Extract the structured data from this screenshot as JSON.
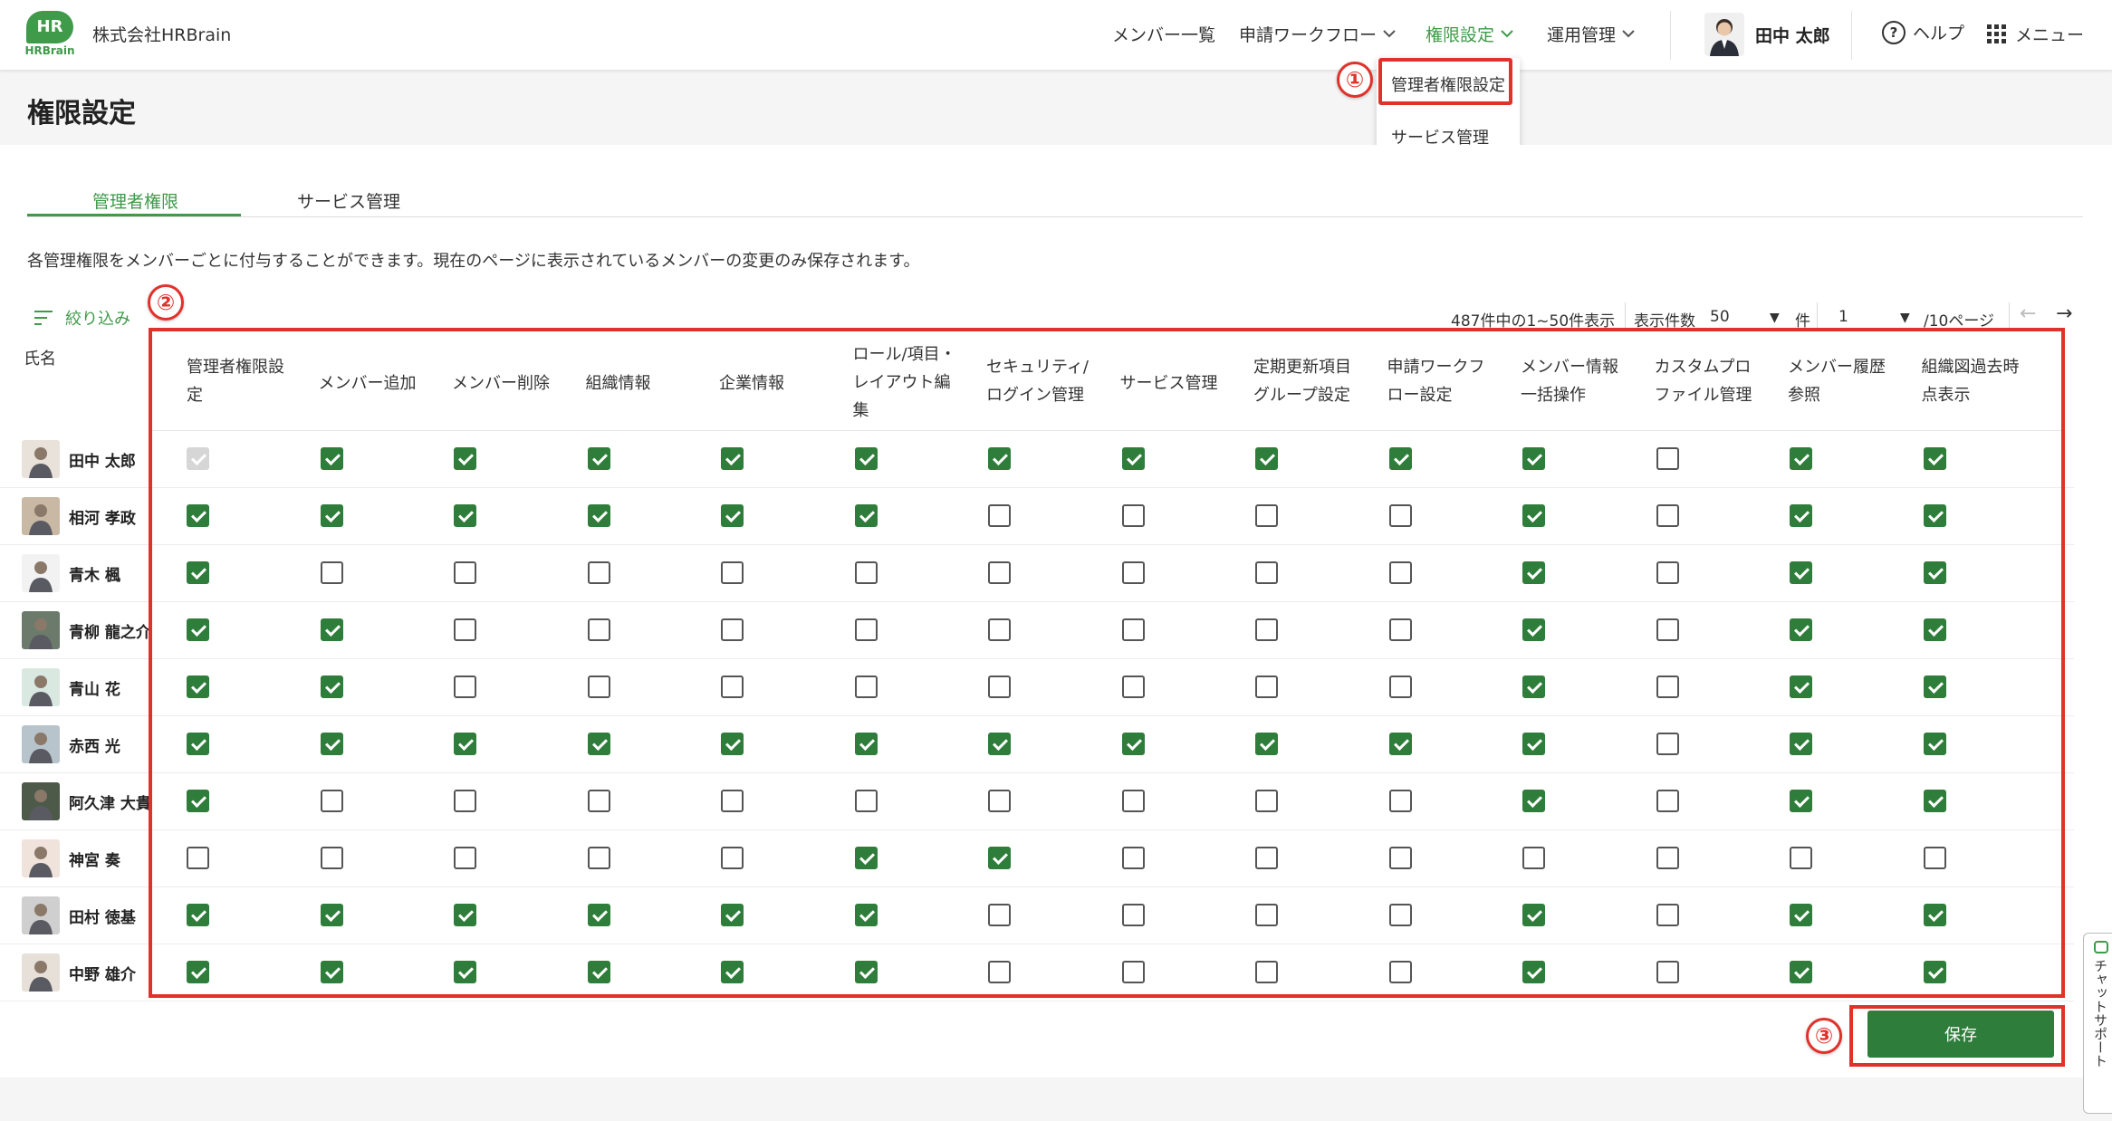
{
  "header": {
    "logo_mark": "HR",
    "logo_sub": "HRBrain",
    "company": "株式会社HRBrain",
    "nav": [
      {
        "label": "メンバー一覧",
        "has_menu": false
      },
      {
        "label": "申請ワークフロー",
        "has_menu": true
      },
      {
        "label": "権限設定",
        "has_menu": true,
        "active": true
      },
      {
        "label": "運用管理",
        "has_menu": true
      }
    ],
    "user_name": "田中 太郎",
    "help_label": "ヘルプ",
    "help_icon_glyph": "?",
    "menu_label": "メニュー"
  },
  "dropdown": {
    "items": [
      "管理者権限設定",
      "サービス管理"
    ]
  },
  "annotations": {
    "badge1": "①",
    "badge2": "②",
    "badge3": "③"
  },
  "page": {
    "title": "権限設定",
    "tabs": [
      "管理者権限",
      "サービス管理"
    ],
    "description": "各管理権限をメンバーごとに付与することができます。現在のページに表示されているメンバーの変更のみ保存されます。"
  },
  "toolbar": {
    "filter_label": "絞り込み",
    "range_text": "487件中の1~50件表示",
    "per_page_label": "表示件数",
    "per_page_value": "50",
    "per_page_unit": "件",
    "page_value": "1",
    "page_total": "/10ページ",
    "prev_glyph": "←",
    "next_glyph": "→"
  },
  "table": {
    "name_header": "氏名",
    "columns": [
      [
        "管理者権限設",
        "定"
      ],
      [
        "メンバー追加"
      ],
      [
        "メンバー削除"
      ],
      [
        "組織情報"
      ],
      [
        "企業情報"
      ],
      [
        "ロール/項目・",
        "レイアウト編",
        "集"
      ],
      [
        "セキュリティ/",
        "ログイン管理"
      ],
      [
        "サービス管理"
      ],
      [
        "定期更新項目",
        "グループ設定"
      ],
      [
        "申請ワークフ",
        "ロー設定"
      ],
      [
        "メンバー情報",
        "一括操作"
      ],
      [
        "カスタムプロ",
        "ファイル管理"
      ],
      [
        "メンバー履歴",
        "参照"
      ],
      [
        "組織図過去時",
        "点表示"
      ]
    ],
    "rows": [
      {
        "name": "田中 太郎",
        "checks": [
          "d",
          1,
          1,
          1,
          1,
          1,
          1,
          1,
          1,
          1,
          1,
          0,
          1,
          1
        ]
      },
      {
        "name": "相河 孝政",
        "checks": [
          1,
          1,
          1,
          1,
          1,
          1,
          0,
          0,
          0,
          0,
          1,
          0,
          1,
          1
        ]
      },
      {
        "name": "青木 楓",
        "checks": [
          1,
          0,
          0,
          0,
          0,
          0,
          0,
          0,
          0,
          0,
          1,
          0,
          1,
          1
        ]
      },
      {
        "name": "青柳 龍之介",
        "checks": [
          1,
          1,
          0,
          0,
          0,
          0,
          0,
          0,
          0,
          0,
          1,
          0,
          1,
          1
        ]
      },
      {
        "name": "青山 花",
        "checks": [
          1,
          1,
          0,
          0,
          0,
          0,
          0,
          0,
          0,
          0,
          1,
          0,
          1,
          1
        ]
      },
      {
        "name": "赤西 光",
        "checks": [
          1,
          1,
          1,
          1,
          1,
          1,
          1,
          1,
          1,
          1,
          1,
          0,
          1,
          1
        ]
      },
      {
        "name": "阿久津 大貴",
        "checks": [
          1,
          0,
          0,
          0,
          0,
          0,
          0,
          0,
          0,
          0,
          1,
          0,
          1,
          1
        ]
      },
      {
        "name": "神宮 奏",
        "checks": [
          0,
          0,
          0,
          0,
          0,
          1,
          1,
          0,
          0,
          0,
          0,
          0,
          0,
          0
        ]
      },
      {
        "name": "田村 徳基",
        "checks": [
          1,
          1,
          1,
          1,
          1,
          1,
          0,
          0,
          0,
          0,
          1,
          0,
          1,
          1
        ]
      },
      {
        "name": "中野 雄介",
        "checks": [
          1,
          1,
          1,
          1,
          1,
          1,
          0,
          0,
          0,
          0,
          1,
          0,
          1,
          1
        ]
      }
    ]
  },
  "save_label": "保存",
  "chat_label": "チャットサポート",
  "colors": {
    "brand": "#3f9a4a",
    "checkbox_on": "#2f7d3a",
    "annotation": "#e0322a"
  }
}
